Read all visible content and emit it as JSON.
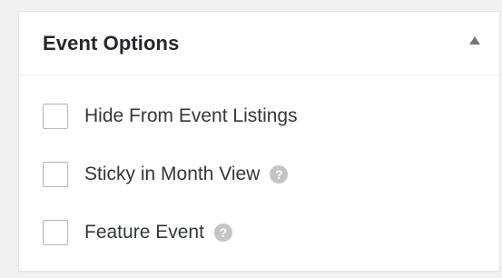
{
  "panel": {
    "title": "Event Options",
    "toggle_icon": "triangle-up-icon",
    "options": [
      {
        "label": "Hide From Event Listings",
        "checked": false,
        "has_help": false
      },
      {
        "label": "Sticky in Month View",
        "checked": false,
        "has_help": true,
        "help_glyph": "?"
      },
      {
        "label": "Feature Event",
        "checked": false,
        "has_help": true,
        "help_glyph": "?"
      }
    ]
  },
  "colors": {
    "page_background": "#f1f1f1",
    "panel_background": "#ffffff",
    "title_text": "#23282d",
    "label_text": "#32373c",
    "help_icon": "#c3c4c7"
  }
}
